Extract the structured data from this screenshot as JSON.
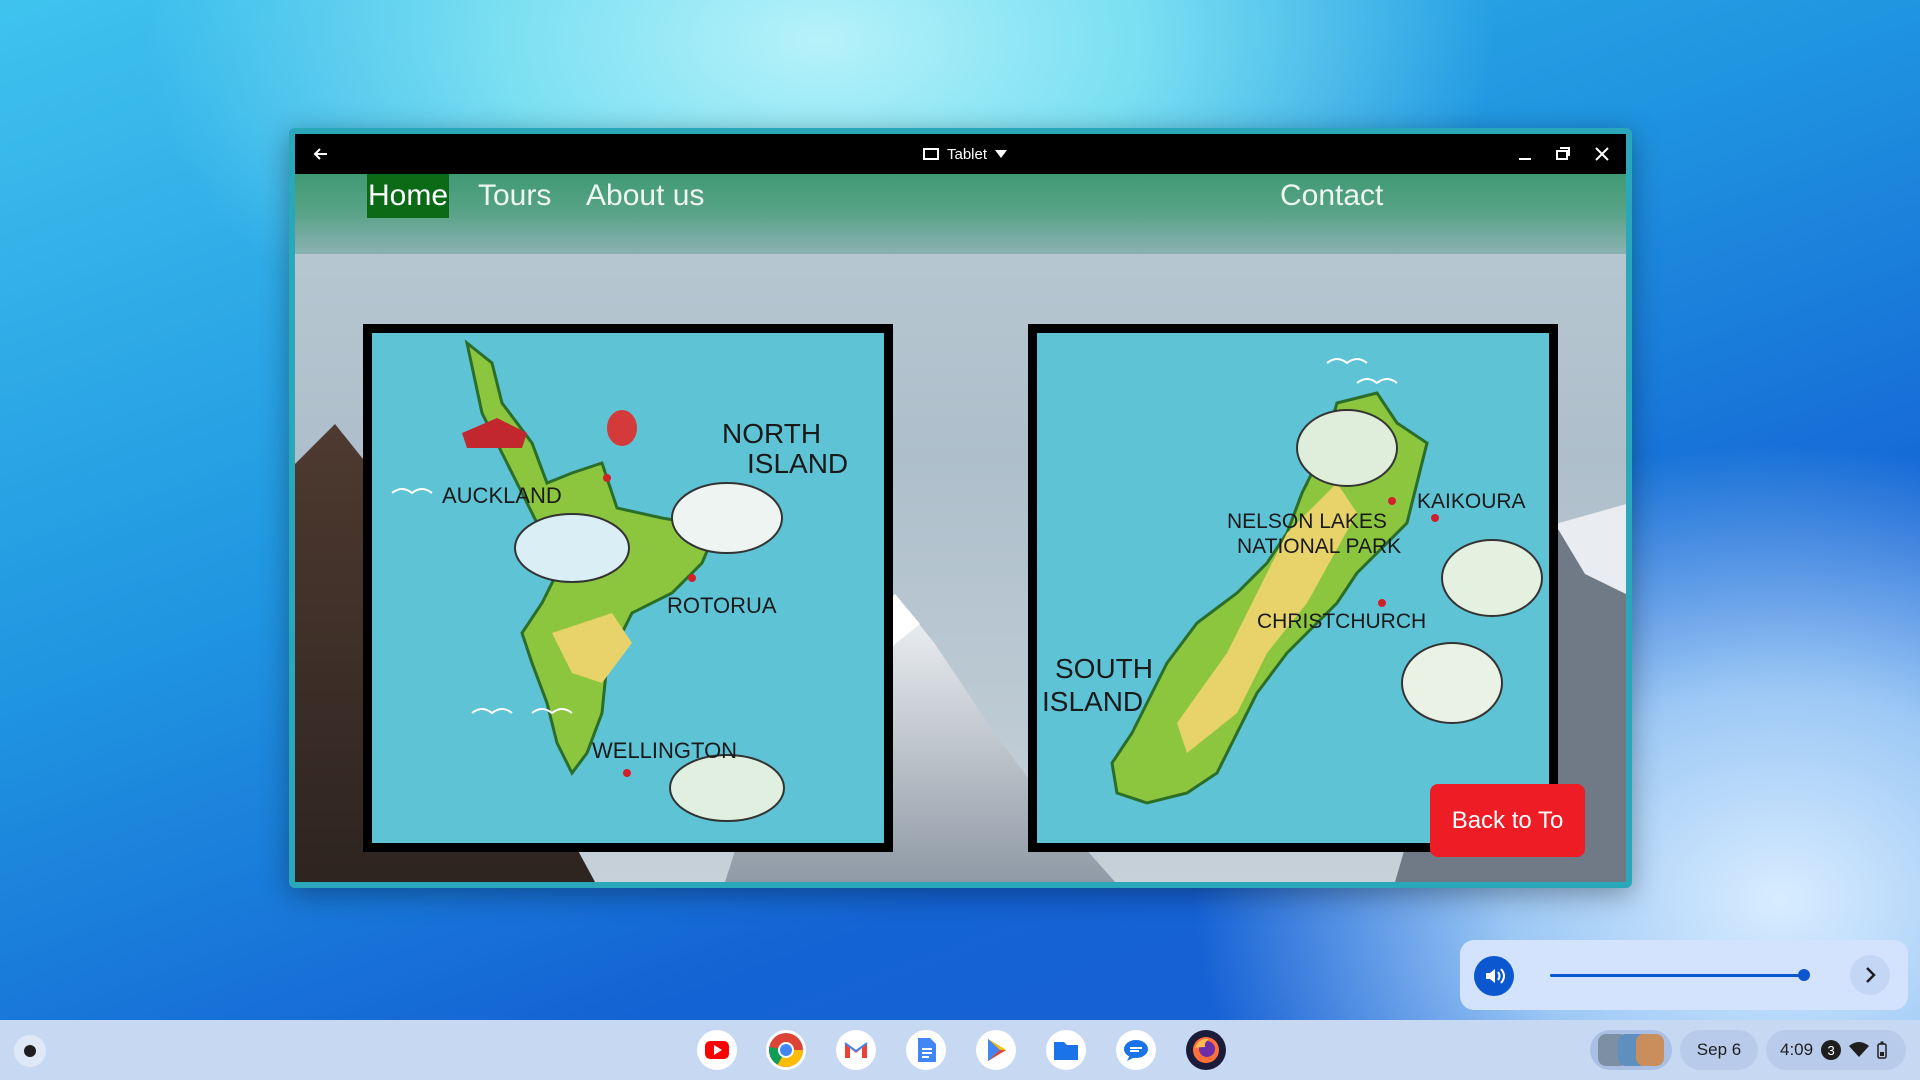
{
  "window": {
    "mode_label": "Tablet"
  },
  "site": {
    "nav": {
      "home": "Home",
      "tours": "Tours",
      "about": "About us",
      "contact": "Contact"
    },
    "north_map": {
      "title_line1": "NORTH",
      "title_line2": "ISLAND",
      "places": [
        "AUCKLAND",
        "ROTORUA",
        "WELLINGTON"
      ]
    },
    "south_map": {
      "title_line1": "SOUTH",
      "title_line2": "ISLAND",
      "places": [
        "NELSON LAKES",
        "NATIONAL PARK",
        "KAIKOURA",
        "CHRISTCHURCH"
      ]
    },
    "back_button": "Back to To"
  },
  "volume": {
    "level": 0.94
  },
  "shelf": {
    "apps": [
      "youtube-icon",
      "chrome-icon",
      "gmail-icon",
      "docs-icon",
      "play-store-icon",
      "files-icon",
      "messages-icon",
      "firefox-icon"
    ],
    "date": "Sep 6",
    "time": "4:09",
    "notification_count": "3"
  }
}
